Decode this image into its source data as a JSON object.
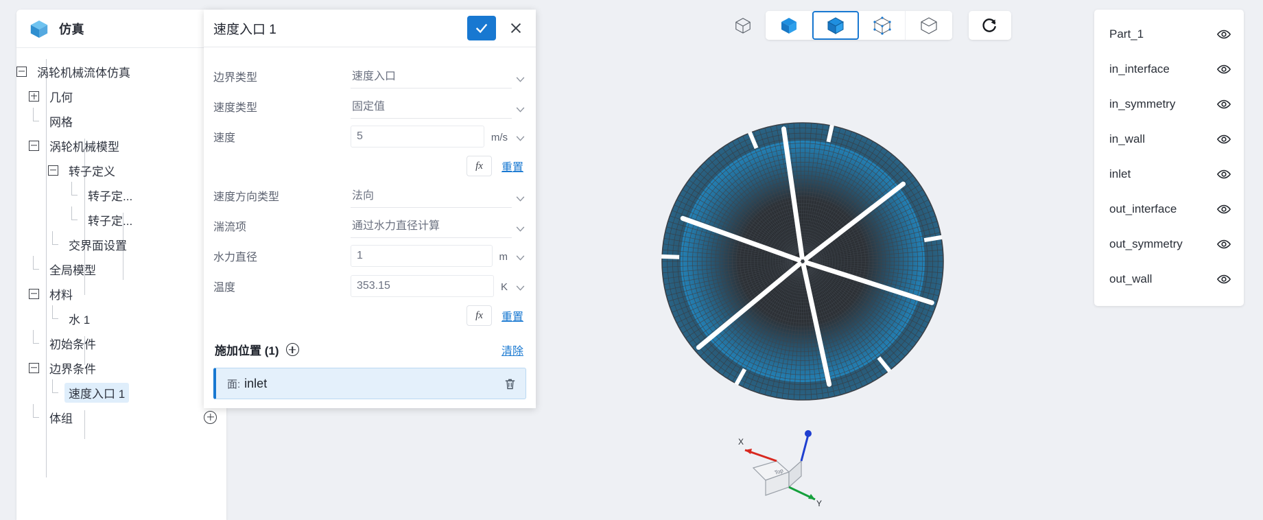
{
  "app": {
    "title": "仿真",
    "logo_icon": "cube-icon",
    "collapse_icon": "caret-down-icon"
  },
  "tree": {
    "nodes": [
      {
        "label": "涡轮机械流体仿真",
        "level": 0,
        "toggle": "minus",
        "badge": "!",
        "action": "none"
      },
      {
        "label": "几何",
        "level": 1,
        "toggle": "plus",
        "action": "none"
      },
      {
        "label": "网格",
        "level": 1,
        "toggle": "leaf",
        "action": "none"
      },
      {
        "label": "涡轮机械模型",
        "level": 1,
        "toggle": "minus",
        "action": "none"
      },
      {
        "label": "转子定义",
        "level": 2,
        "toggle": "minus",
        "action": "plus"
      },
      {
        "label": "转子定...",
        "level": 3,
        "toggle": "leaf",
        "action": "menu"
      },
      {
        "label": "转子定...",
        "level": 3,
        "toggle": "leaf",
        "action": "menu"
      },
      {
        "label": "交界面设置",
        "level": 2,
        "toggle": "leaf",
        "action": "plus"
      },
      {
        "label": "全局模型",
        "level": 1,
        "toggle": "leaf",
        "action": "none"
      },
      {
        "label": "材料",
        "level": 1,
        "toggle": "minus",
        "action": "none"
      },
      {
        "label": "水 1",
        "level": 2,
        "toggle": "leaf",
        "action": "menu"
      },
      {
        "label": "初始条件",
        "level": 1,
        "toggle": "leaf",
        "action": "none"
      },
      {
        "label": "边界条件",
        "level": 1,
        "toggle": "minus",
        "action": "plus"
      },
      {
        "label": "速度入口 1",
        "level": 2,
        "toggle": "leaf",
        "action": "menu",
        "selected": true
      },
      {
        "label": "体组",
        "level": 1,
        "toggle": "leaf",
        "action": "plus"
      }
    ]
  },
  "dialog": {
    "title": "速度入口 1",
    "confirm_icon": "check-icon",
    "cancel_icon": "close-icon",
    "fields": [
      {
        "label": "边界类型",
        "value": "速度入口",
        "unit": "",
        "dropdown": true,
        "boxed": false
      },
      {
        "label": "速度类型",
        "value": "固定值",
        "unit": "",
        "dropdown": true,
        "boxed": false
      },
      {
        "label": "速度",
        "value": "5",
        "unit": "m/s",
        "dropdown": true,
        "boxed": true
      },
      {
        "label": "速度方向类型",
        "value": "法向",
        "unit": "",
        "dropdown": true,
        "boxed": false
      },
      {
        "label": "湍流项",
        "value": "通过水力直径计算",
        "unit": "",
        "dropdown": true,
        "boxed": false
      },
      {
        "label": "水力直径",
        "value": "1",
        "unit": "m",
        "dropdown": true,
        "boxed": true
      },
      {
        "label": "温度",
        "value": "353.15",
        "unit": "K",
        "dropdown": true,
        "boxed": true
      }
    ],
    "fx_label": "fx",
    "reset_label": "重置",
    "section": {
      "title": "施加位置 (1)",
      "add_icon": "plus-circle-icon",
      "clear_label": "清除"
    },
    "selection": {
      "prefix": "面:",
      "name": "inlet",
      "delete_icon": "trash-icon"
    }
  },
  "toolbar": {
    "buttons": [
      {
        "name": "view-wireframe-plain",
        "icon": "cube-wireframe-icon",
        "active": false,
        "style": "plain"
      },
      {
        "name": "view-shaded",
        "icon": "cube-solid-icon",
        "active": false,
        "style": "group"
      },
      {
        "name": "view-shaded-edges",
        "icon": "cube-shaded-icon",
        "active": true,
        "style": "group"
      },
      {
        "name": "view-mesh",
        "icon": "cube-points-icon",
        "active": false,
        "style": "group"
      },
      {
        "name": "view-wireframe",
        "icon": "cube-outline-icon",
        "active": false,
        "style": "group"
      },
      {
        "name": "reset-view",
        "icon": "refresh-icon",
        "active": false,
        "style": "single"
      }
    ]
  },
  "parts": {
    "items": [
      {
        "label": "Part_1",
        "visible_icon": "eye-icon"
      },
      {
        "label": "in_interface",
        "visible_icon": "eye-icon"
      },
      {
        "label": "in_symmetry",
        "visible_icon": "eye-icon"
      },
      {
        "label": "in_wall",
        "visible_icon": "eye-icon"
      },
      {
        "label": "inlet",
        "visible_icon": "eye-icon"
      },
      {
        "label": "out_interface",
        "visible_icon": "eye-icon"
      },
      {
        "label": "out_symmetry",
        "visible_icon": "eye-icon"
      },
      {
        "label": "out_wall",
        "visible_icon": "eye-icon"
      }
    ]
  },
  "viewport": {
    "mesh_color": "#1f9be0",
    "mesh_line_color": "#4a4f57",
    "background": "#eef0f4"
  },
  "triad": {
    "x_label": "X",
    "y_label": "Y",
    "face_label": "Top"
  }
}
